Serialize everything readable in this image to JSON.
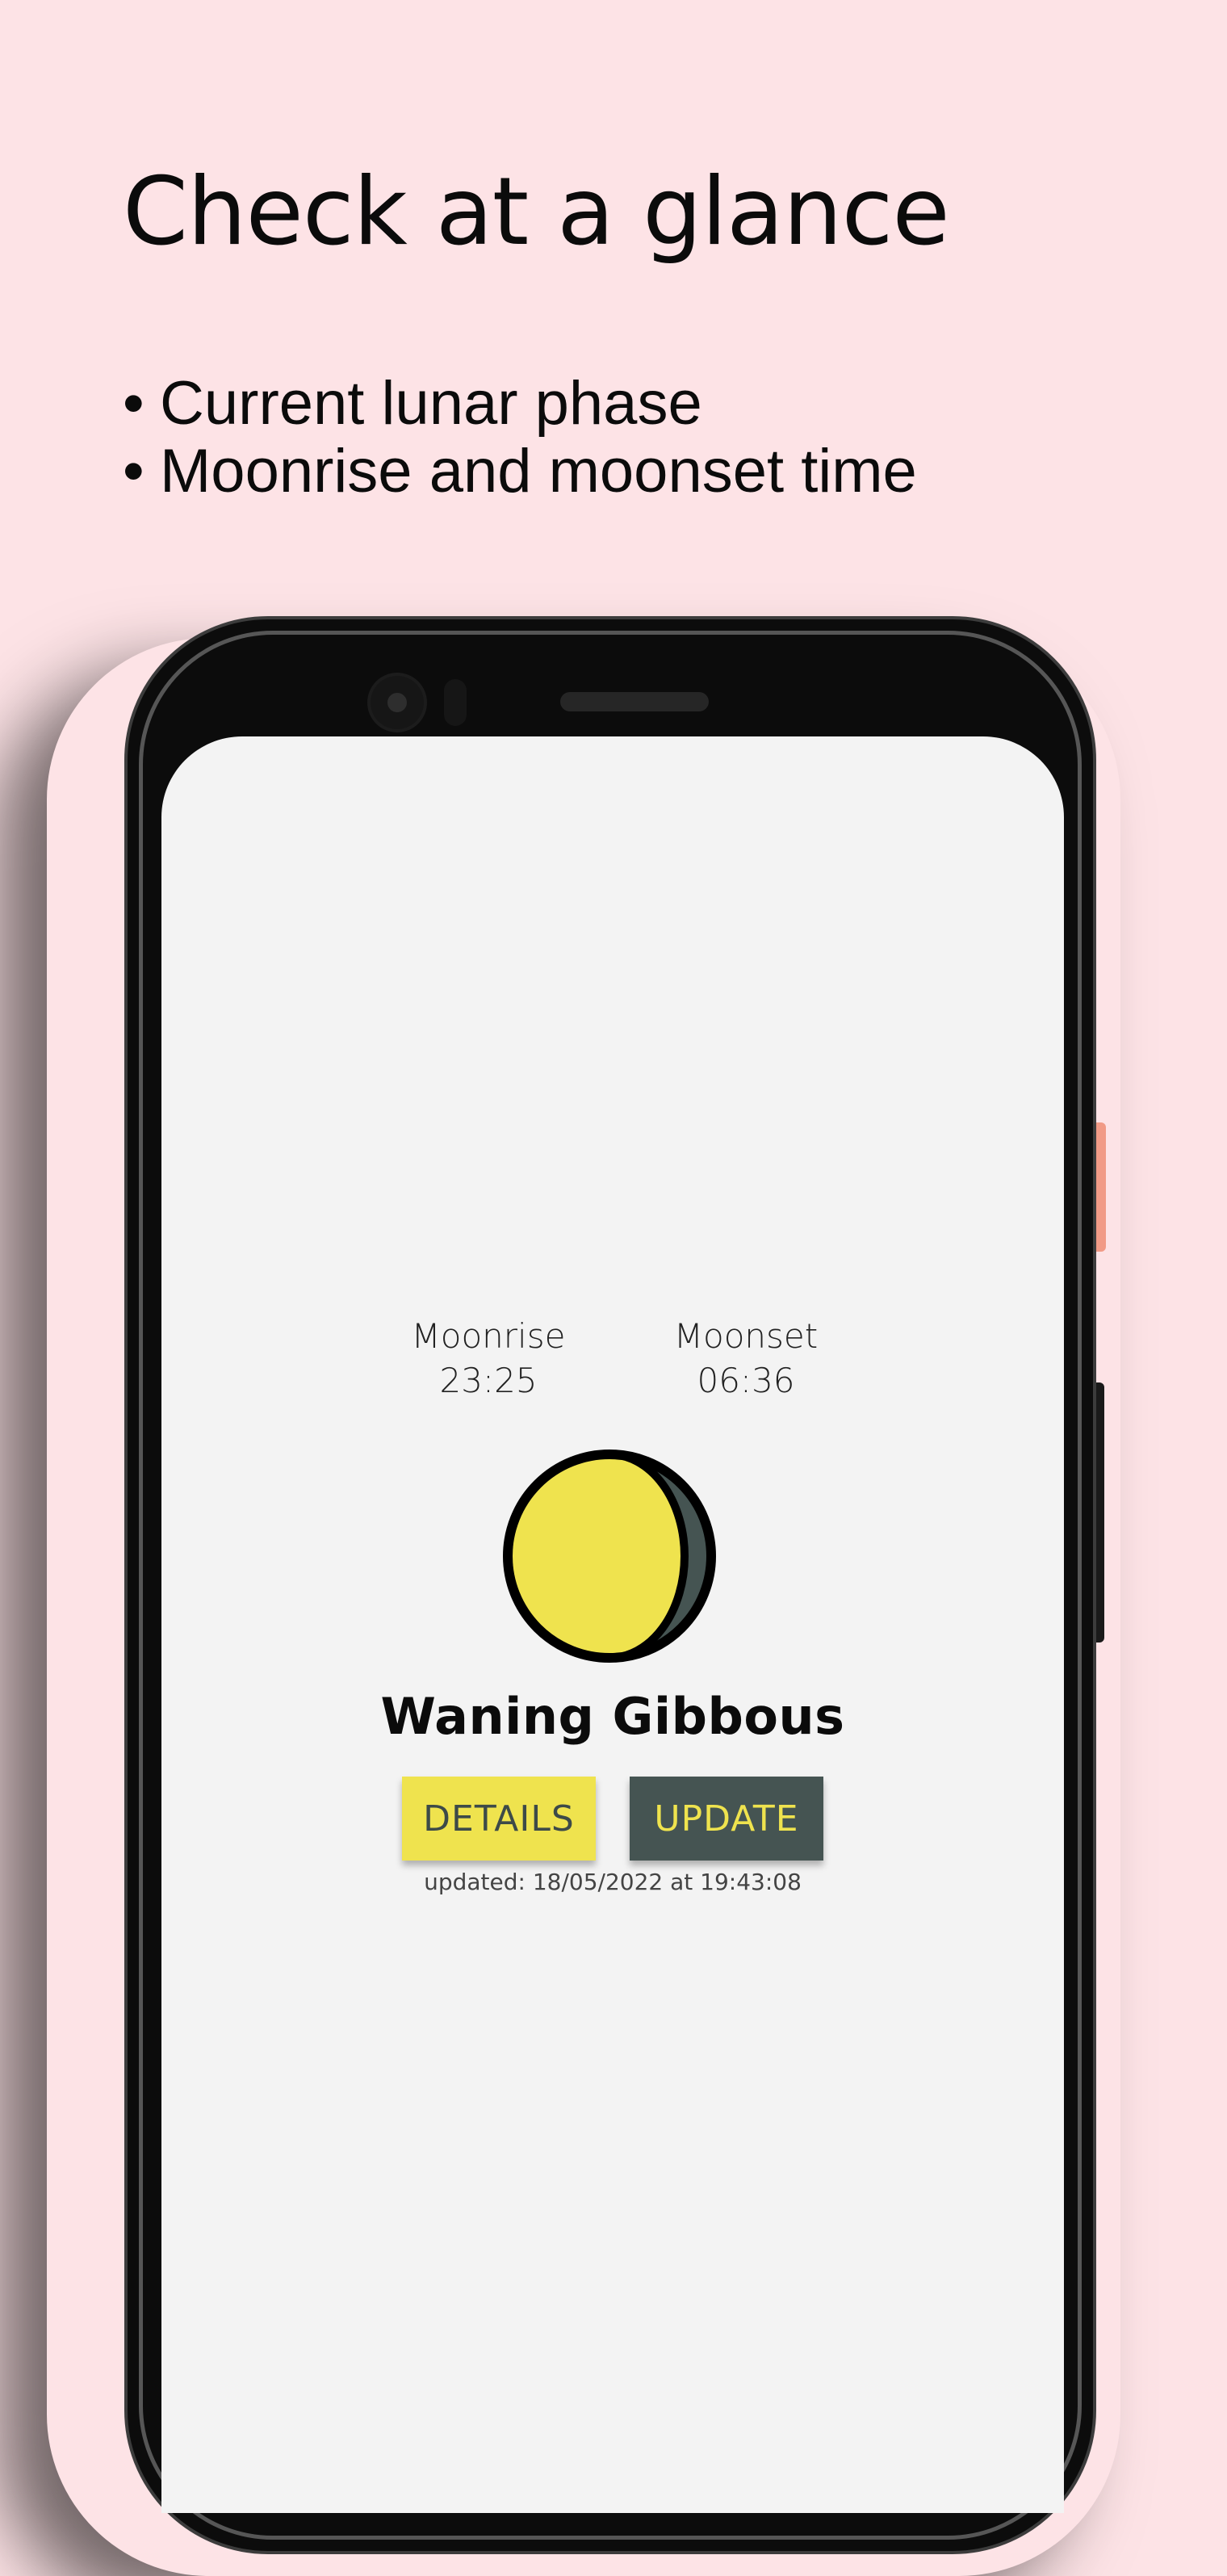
{
  "promo": {
    "headline": "Check at a glance",
    "bullets": [
      "Current lunar phase",
      "Moonrise and moonset time"
    ]
  },
  "app": {
    "moonrise": {
      "label": "Moonrise",
      "time": "23:25"
    },
    "moonset": {
      "label": "Moonset",
      "time": "06:36"
    },
    "moon": {
      "phase_icon": "waning-gibbous-moon-icon",
      "lit_color": "#efe34e",
      "shadow_color": "#455452"
    },
    "phase_name": "Waning Gibbous",
    "buttons": {
      "details_label": "DETAILS",
      "update_label": "UPDATE"
    },
    "updated_text": "updated: 18/05/2022 at 19:43:08"
  },
  "colors": {
    "background": "#fde3e6",
    "screen": "#f3f3f3",
    "accent_yellow": "#efe34e",
    "accent_dark": "#455452"
  }
}
